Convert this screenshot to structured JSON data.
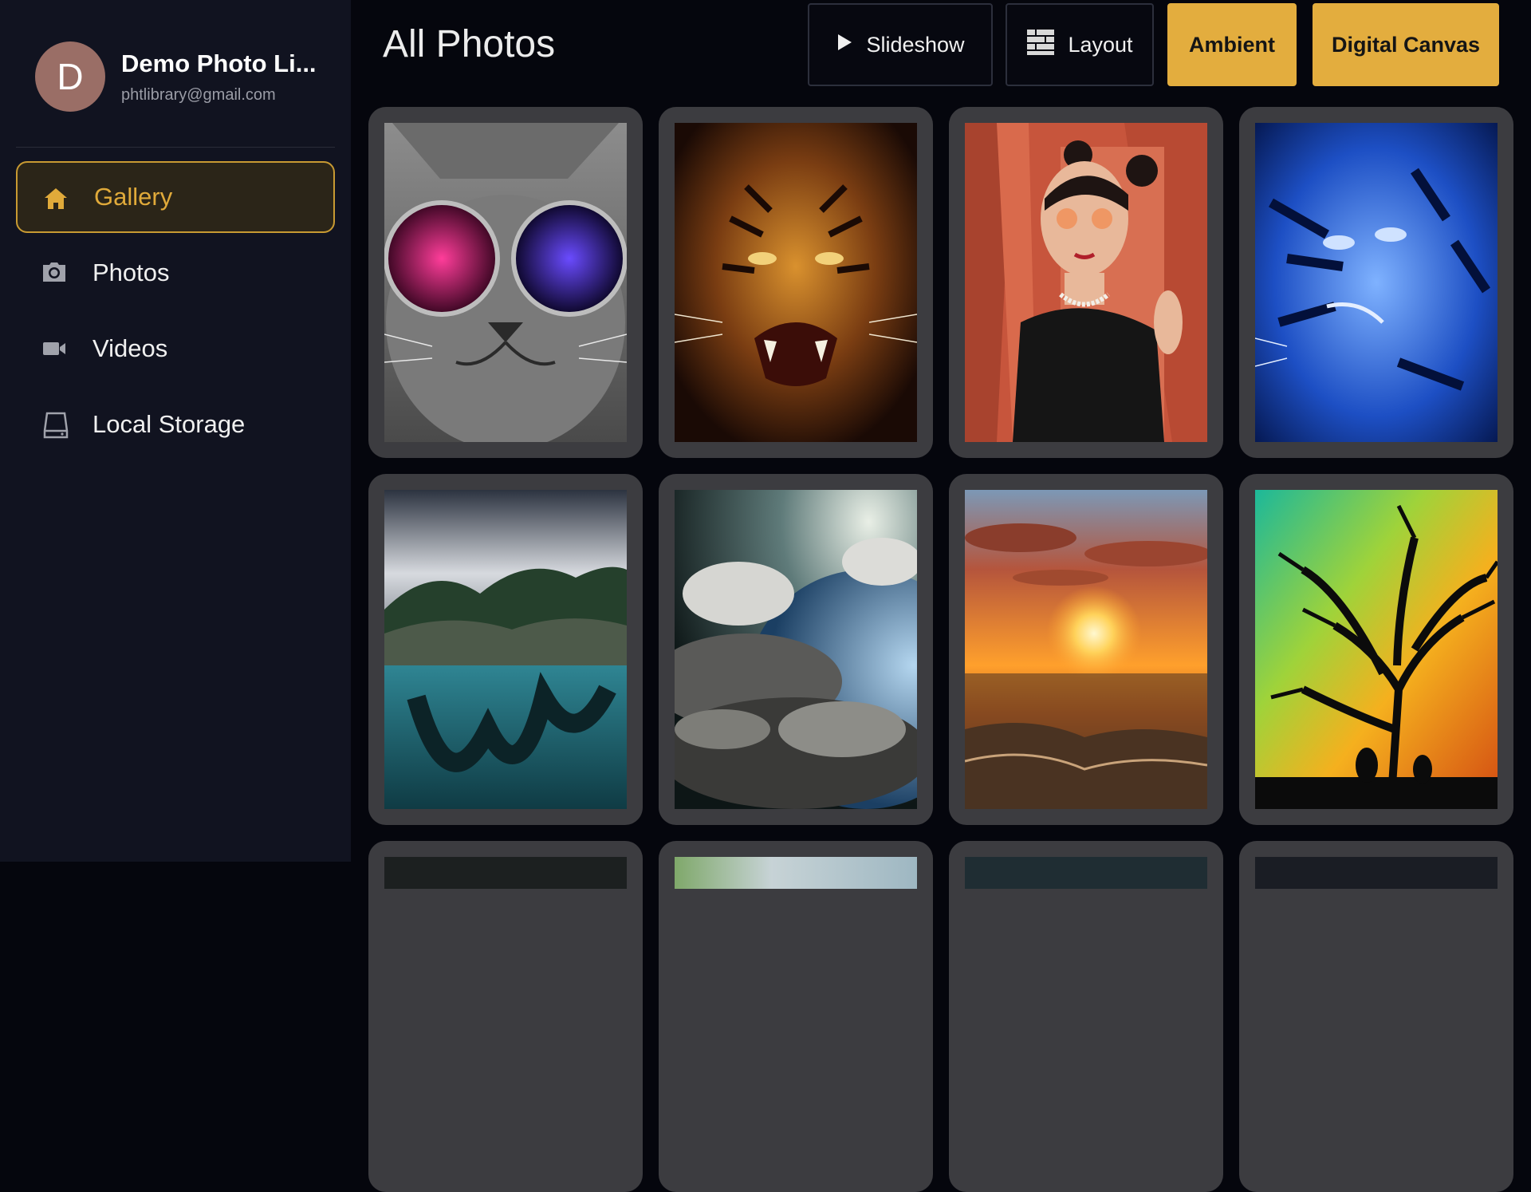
{
  "profile": {
    "initial": "D",
    "name": "Demo Photo Li...",
    "email": "phtlibrary@gmail.com"
  },
  "sidebar": {
    "items": [
      {
        "label": "Gallery",
        "icon": "home-icon",
        "active": true
      },
      {
        "label": "Photos",
        "icon": "camera-icon",
        "active": false
      },
      {
        "label": "Videos",
        "icon": "video-camera-icon",
        "active": false
      },
      {
        "label": "Local Storage",
        "icon": "storage-drive-icon",
        "active": false
      }
    ]
  },
  "header": {
    "title": "All Photos",
    "buttons": {
      "slideshow": "Slideshow",
      "layout": "Layout",
      "ambient": "Ambient",
      "digital_canvas": "Digital Canvas"
    }
  },
  "colors": {
    "accent": "#e3ad3e",
    "background": "#05060d",
    "sidebar": "#111320",
    "card": "#3c3c40"
  },
  "photos": [
    {
      "subject": "cat with cosmic sunglasses"
    },
    {
      "subject": "roaring tiger"
    },
    {
      "subject": "woman with red curtain"
    },
    {
      "subject": "blue tiger"
    },
    {
      "subject": "island lake with clouds"
    },
    {
      "subject": "planet in clouds"
    },
    {
      "subject": "sunset over sea"
    },
    {
      "subject": "colorful tree silhouette"
    }
  ]
}
